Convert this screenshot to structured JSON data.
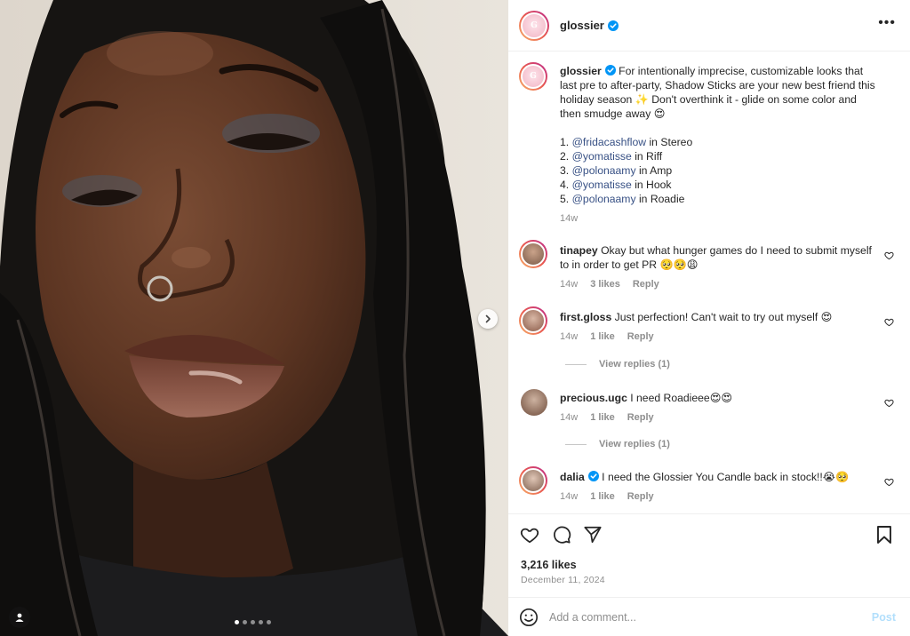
{
  "post": {
    "author": "glossier",
    "more_label": "•••",
    "caption": {
      "author": "glossier",
      "text": "For intentionally imprecise, customizable looks that last pre to after-party, Shadow Sticks are your new best friend this holiday season ✨ Don't overthink it - glide on some color and then smudge away 😍",
      "list": [
        {
          "num": "1.",
          "mention": "@fridacashflow",
          "rest": "in Stereo"
        },
        {
          "num": "2.",
          "mention": "@yomatisse",
          "rest": "in Riff"
        },
        {
          "num": "3.",
          "mention": "@polonaamy",
          "rest": "in Amp"
        },
        {
          "num": "4.",
          "mention": "@yomatisse",
          "rest": "in Hook"
        },
        {
          "num": "5.",
          "mention": "@polonaamy",
          "rest": "in Roadie"
        }
      ],
      "time": "14w"
    },
    "comments": [
      {
        "user": "tinapey",
        "text": "Okay but what hunger games do I need to submit myself to in order to get PR 🥺🥺😩",
        "time": "14w",
        "likes": "3 likes",
        "reply": "Reply"
      },
      {
        "user": "first.gloss",
        "text": "Just perfection! Can't wait to try out myself 😍",
        "time": "14w",
        "likes": "1 like",
        "reply": "Reply",
        "view_replies": "View replies (1)"
      },
      {
        "user": "precious.ugc",
        "text": "I need Roadieee😍😍",
        "time": "14w",
        "likes": "1 like",
        "reply": "Reply",
        "view_replies": "View replies (1)"
      },
      {
        "user": "dalia",
        "text": "I need the Glossier You Candle back in stock!!😭🥺",
        "time": "14w",
        "likes": "1 like",
        "reply": "Reply"
      }
    ],
    "likes_count": "3,216 likes",
    "date": "December 11, 2024",
    "comment_placeholder": "Add a comment...",
    "post_label": "Post",
    "carousel": {
      "total": 5,
      "active": 1
    }
  },
  "colors": {
    "mention": "#385185",
    "verified": "#0095f6",
    "post_disabled": "#b2dffc"
  }
}
